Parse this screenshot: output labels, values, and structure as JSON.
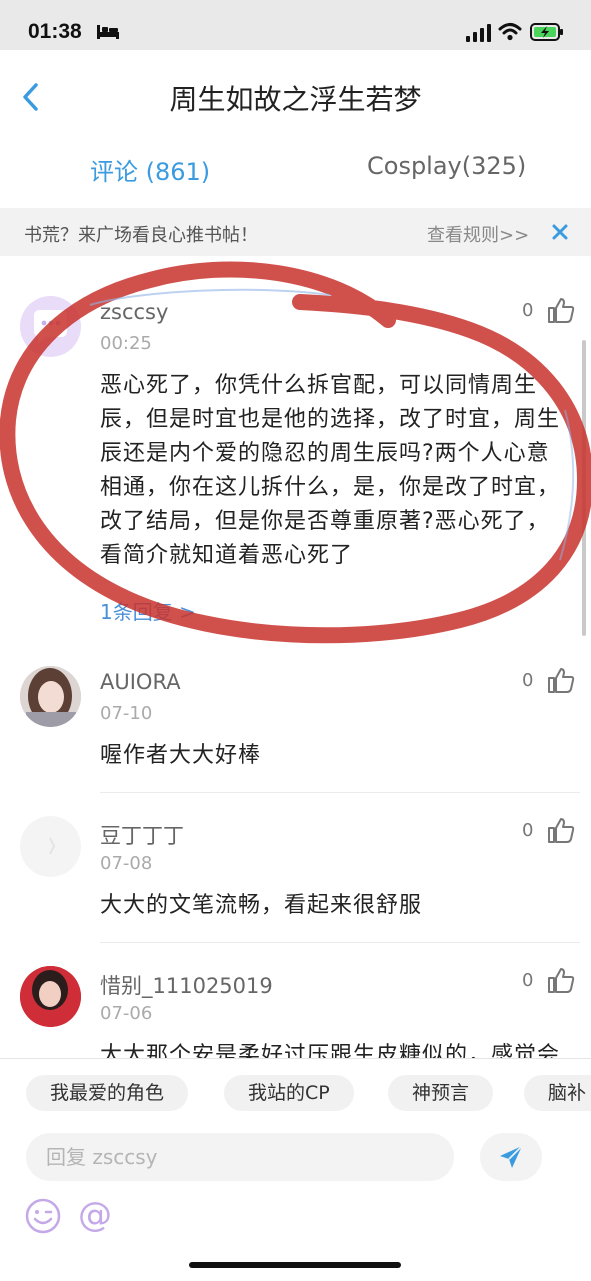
{
  "status_bar": {
    "time": "01:38"
  },
  "header": {
    "title": "周生如故之浮生若梦"
  },
  "tabs": [
    {
      "label": "评论 (861)"
    },
    {
      "label": "Cosplay(325)"
    }
  ],
  "notice": {
    "text": "书荒？来广场看良心推书帖！",
    "link": "查看规则>>"
  },
  "comments": [
    {
      "user": "zsccsy",
      "time": "00:25",
      "likes": "0",
      "body": "恶心死了，你凭什么拆官配，可以同情周生辰，但是时宜也是他的选择，改了时宜，周生辰还是内个爱的隐忍的周生辰吗?两个人心意相通，你在这儿拆什么，是，你是改了时宜，改了结局，但是你是否尊重原著?恶心死了，看简介就知道着恶心死了",
      "replies": "1条回复 >"
    },
    {
      "user": "AUIORA",
      "time": "07-10",
      "likes": "0",
      "body": "喔作者大大好棒"
    },
    {
      "user": "豆丁丁丁",
      "time": "07-08",
      "likes": "0",
      "body": "大大的文笔流畅，看起来很舒服"
    },
    {
      "user": "惜别_111025019",
      "time": "07-06",
      "likes": "0",
      "body": "大大那个安是柔好过压跟生皮糖似的，感觉会"
    }
  ],
  "chips": [
    {
      "label": "我最爱的角色"
    },
    {
      "label": "我站的CP"
    },
    {
      "label": "神预言"
    },
    {
      "label": "脑补"
    }
  ],
  "reply": {
    "placeholder": "回复 zsccsy"
  },
  "colors": {
    "accent": "#3a9be0",
    "annotation_red": "#c8322d",
    "emoji_purple": "#c4a8e8"
  }
}
